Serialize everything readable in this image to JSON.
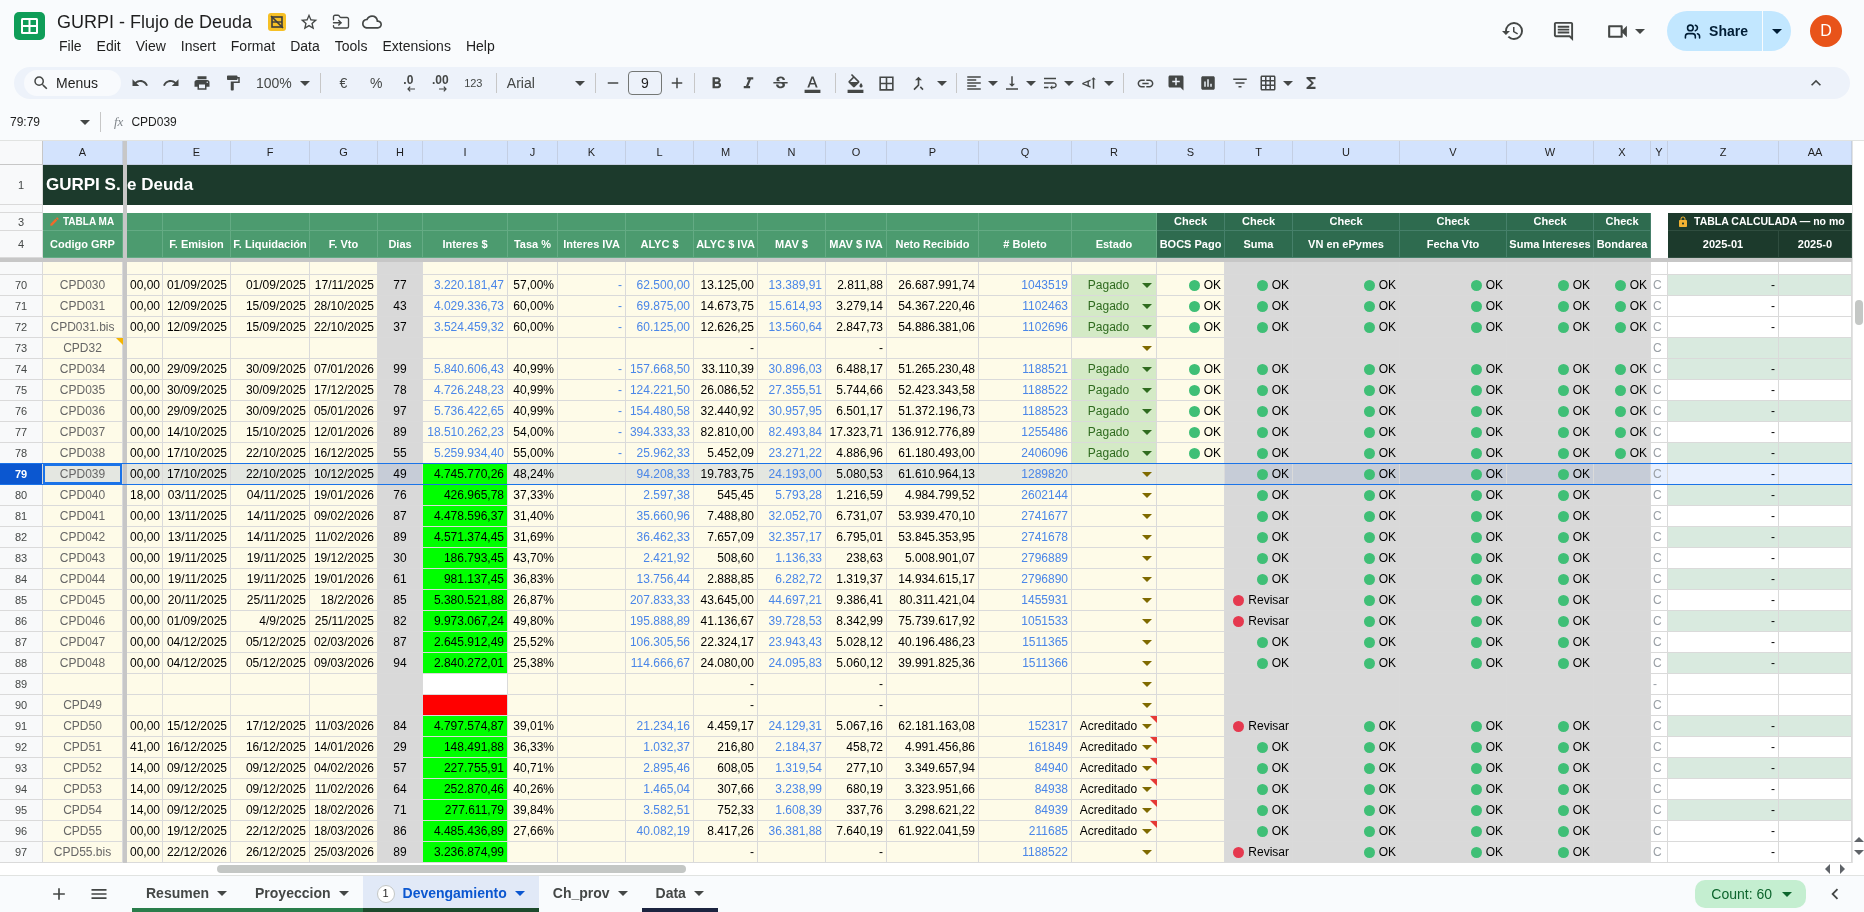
{
  "document": {
    "title": "GURPI - Flujo de Deuda",
    "starred": false
  },
  "menus": [
    "File",
    "Edit",
    "View",
    "Insert",
    "Format",
    "Data",
    "Tools",
    "Extensions",
    "Help"
  ],
  "account": {
    "share": "Share",
    "avatar": "D"
  },
  "toolbar": {
    "menu_search": "Menus",
    "zoom": "100%",
    "currency": "€",
    "percent": "%",
    "decrease_decimals": ".0",
    "increase_decimals": ".00",
    "number_format": "123",
    "font": "Arial",
    "font_size": "9"
  },
  "formula_bar": {
    "name_box": "79:79",
    "function_label": "fx",
    "formula": "CPD039"
  },
  "table": {
    "column_headers": [
      "A",
      "E",
      "F",
      "G",
      "H",
      "I",
      "J",
      "K",
      "L",
      "M",
      "N",
      "O",
      "P",
      "Q",
      "R",
      "S",
      "T",
      "U",
      "V",
      "W",
      "X",
      "Y",
      "Z",
      "AA"
    ],
    "title_row": {
      "row": "1",
      "left": "GURPI S.",
      "right": "e Deuda"
    },
    "group_row": {
      "row": "3",
      "A": "TABLA MA",
      "S": "Check",
      "T": "Check",
      "U": "Check",
      "V": "Check",
      "W": "Check",
      "X": "Check",
      "Z": "TABLA CALCULADA — no mo"
    },
    "label_row": {
      "row": "4",
      "A": "Codigo GRP",
      "E": "F. Emision",
      "F": "F. Liquidación",
      "G": "F. Vto",
      "H": "Dias",
      "I": "Interes $",
      "J": "Tasa %",
      "K": "Interes IVA",
      "L": "ALYC $",
      "M": "ALYC $ IVA",
      "N": "MAV $",
      "O": "MAV $ IVA",
      "P": "Neto Recibido",
      "Q": "# Boleto",
      "R": "Estado",
      "S": "BOCS Pago",
      "T": "Suma",
      "U": "VN en ePymes",
      "V": "Fecha Vto",
      "W": "Suma Intereses",
      "X": "Bondarea",
      "Z": "2025-01",
      "AA": "2025-0"
    },
    "rows": [
      {
        "row": "70",
        "selected": false,
        "band": true,
        "A": {
          "text": "CPD030",
          "note": false
        },
        "D": "00,00",
        "E": "01/09/2025",
        "F": "01/09/2025",
        "G": "17/11/2025",
        "H": "77",
        "I": {
          "text": "3.220.181,47"
        },
        "J": "57,00%",
        "K": "-",
        "L": "62.500,00",
        "M": "13.125,00",
        "N": "13.389,91",
        "O": "2.811,88",
        "P": "26.687.991,74",
        "Q": "1043519",
        "R": {
          "text": "Pagado",
          "color": "#d4eac6",
          "note": false
        },
        "S": {
          "text": "OK",
          "color": "#3fbf76"
        },
        "T": {
          "text": "OK",
          "color": "#3fbf76"
        },
        "U": {
          "text": "OK",
          "color": "#3fbf76"
        },
        "V": {
          "text": "OK",
          "color": "#3fbf76"
        },
        "W": {
          "text": "OK",
          "color": "#3fbf76"
        },
        "X": {
          "text": "OK",
          "color": "#3fbf76"
        },
        "Y": "C",
        "Z": "-"
      },
      {
        "row": "71",
        "selected": false,
        "band": false,
        "A": {
          "text": "CPD031",
          "note": false
        },
        "D": "00,00",
        "E": "12/09/2025",
        "F": "15/09/2025",
        "G": "28/10/2025",
        "H": "43",
        "I": {
          "text": "4.029.336,73"
        },
        "J": "60,00%",
        "K": "-",
        "L": "69.875,00",
        "M": "14.673,75",
        "N": "15.614,93",
        "O": "3.279,14",
        "P": "54.367.220,46",
        "Q": "1102463",
        "R": {
          "text": "Pagado",
          "color": "#d4eac6",
          "note": false
        },
        "S": {
          "text": "OK",
          "color": "#3fbf76"
        },
        "T": {
          "text": "OK",
          "color": "#3fbf76"
        },
        "U": {
          "text": "OK",
          "color": "#3fbf76"
        },
        "V": {
          "text": "OK",
          "color": "#3fbf76"
        },
        "W": {
          "text": "OK",
          "color": "#3fbf76"
        },
        "X": {
          "text": "OK",
          "color": "#3fbf76"
        },
        "Y": "C",
        "Z": "-"
      },
      {
        "row": "72",
        "selected": false,
        "band": false,
        "A": {
          "text": "CPD031.bis",
          "note": false
        },
        "D": "00,00",
        "E": "12/09/2025",
        "F": "15/09/2025",
        "G": "22/10/2025",
        "H": "37",
        "I": {
          "text": "3.524.459,32"
        },
        "J": "60,00%",
        "K": "-",
        "L": "60.125,00",
        "M": "12.626,25",
        "N": "13.560,64",
        "O": "2.847,73",
        "P": "54.886.381,06",
        "Q": "1102696",
        "R": {
          "text": "Pagado",
          "color": "#d4eac6",
          "note": false
        },
        "S": {
          "text": "OK",
          "color": "#3fbf76"
        },
        "T": {
          "text": "OK",
          "color": "#3fbf76"
        },
        "U": {
          "text": "OK",
          "color": "#3fbf76"
        },
        "V": {
          "text": "OK",
          "color": "#3fbf76"
        },
        "W": {
          "text": "OK",
          "color": "#3fbf76"
        },
        "X": {
          "text": "OK",
          "color": "#3fbf76"
        },
        "Y": "C",
        "Z": "-"
      },
      {
        "row": "73",
        "selected": false,
        "band": true,
        "A": {
          "text": "CPD32",
          "note": true
        },
        "M": "-",
        "O": "-",
        "R": {
          "note": false
        },
        "Y": "C"
      },
      {
        "row": "74",
        "selected": false,
        "band": true,
        "A": {
          "text": "CPD034",
          "note": false
        },
        "D": "00,00",
        "E": "29/09/2025",
        "F": "30/09/2025",
        "G": "07/01/2026",
        "H": "99",
        "I": {
          "text": "5.840.606,43"
        },
        "J": "40,99%",
        "K": "-",
        "L": "157.668,50",
        "M": "33.110,39",
        "N": "30.896,03",
        "O": "6.488,17",
        "P": "51.265.230,48",
        "Q": "1188521",
        "R": {
          "text": "Pagado",
          "color": "#d4eac6",
          "note": false
        },
        "S": {
          "text": "OK",
          "color": "#3fbf76"
        },
        "T": {
          "text": "OK",
          "color": "#3fbf76"
        },
        "U": {
          "text": "OK",
          "color": "#3fbf76"
        },
        "V": {
          "text": "OK",
          "color": "#3fbf76"
        },
        "W": {
          "text": "OK",
          "color": "#3fbf76"
        },
        "X": {
          "text": "OK",
          "color": "#3fbf76"
        },
        "Y": "C",
        "Z": "-"
      },
      {
        "row": "75",
        "selected": false,
        "band": false,
        "A": {
          "text": "CPD035",
          "note": false
        },
        "D": "00,00",
        "E": "30/09/2025",
        "F": "30/09/2025",
        "G": "17/12/2025",
        "H": "78",
        "I": {
          "text": "4.726.248,23"
        },
        "J": "40,99%",
        "K": "-",
        "L": "124.221,50",
        "M": "26.086,52",
        "N": "27.355,51",
        "O": "5.744,66",
        "P": "52.423.343,58",
        "Q": "1188522",
        "R": {
          "text": "Pagado",
          "color": "#d4eac6",
          "note": false
        },
        "S": {
          "text": "OK",
          "color": "#3fbf76"
        },
        "T": {
          "text": "OK",
          "color": "#3fbf76"
        },
        "U": {
          "text": "OK",
          "color": "#3fbf76"
        },
        "V": {
          "text": "OK",
          "color": "#3fbf76"
        },
        "W": {
          "text": "OK",
          "color": "#3fbf76"
        },
        "X": {
          "text": "OK",
          "color": "#3fbf76"
        },
        "Y": "C",
        "Z": "-"
      },
      {
        "row": "76",
        "selected": false,
        "band": true,
        "A": {
          "text": "CPD036",
          "note": false
        },
        "D": "00,00",
        "E": "29/09/2025",
        "F": "30/09/2025",
        "G": "05/01/2026",
        "H": "97",
        "I": {
          "text": "5.736.422,65"
        },
        "J": "40,99%",
        "K": "-",
        "L": "154.480,58",
        "M": "32.440,92",
        "N": "30.957,95",
        "O": "6.501,17",
        "P": "51.372.196,73",
        "Q": "1188523",
        "R": {
          "text": "Pagado",
          "color": "#d4eac6",
          "note": false
        },
        "S": {
          "text": "OK",
          "color": "#3fbf76"
        },
        "T": {
          "text": "OK",
          "color": "#3fbf76"
        },
        "U": {
          "text": "OK",
          "color": "#3fbf76"
        },
        "V": {
          "text": "OK",
          "color": "#3fbf76"
        },
        "W": {
          "text": "OK",
          "color": "#3fbf76"
        },
        "X": {
          "text": "OK",
          "color": "#3fbf76"
        },
        "Y": "C",
        "Z": "-"
      },
      {
        "row": "77",
        "selected": false,
        "band": false,
        "A": {
          "text": "CPD037",
          "note": false
        },
        "D": "00,00",
        "E": "14/10/2025",
        "F": "15/10/2025",
        "G": "12/01/2026",
        "H": "89",
        "I": {
          "text": "18.510.262,23"
        },
        "J": "54,00%",
        "K": "-",
        "L": "394.333,33",
        "M": "82.810,00",
        "N": "82.493,84",
        "O": "17.323,71",
        "P": "136.912.776,89",
        "Q": "1255486",
        "R": {
          "text": "Pagado",
          "color": "#d4eac6",
          "note": false
        },
        "S": {
          "text": "OK",
          "color": "#3fbf76"
        },
        "T": {
          "text": "OK",
          "color": "#3fbf76"
        },
        "U": {
          "text": "OK",
          "color": "#3fbf76"
        },
        "V": {
          "text": "OK",
          "color": "#3fbf76"
        },
        "W": {
          "text": "OK",
          "color": "#3fbf76"
        },
        "X": {
          "text": "OK",
          "color": "#3fbf76"
        },
        "Y": "C",
        "Z": "-"
      },
      {
        "row": "78",
        "selected": false,
        "band": true,
        "A": {
          "text": "CPD038",
          "note": false
        },
        "D": "00,00",
        "E": "17/10/2025",
        "F": "22/10/2025",
        "G": "16/12/2025",
        "H": "55",
        "I": {
          "text": "5.259.934,40"
        },
        "J": "55,00%",
        "K": "-",
        "L": "25.962,33",
        "M": "5.452,09",
        "N": "23.271,22",
        "O": "4.886,96",
        "P": "61.180.493,00",
        "Q": "2406096",
        "R": {
          "text": "Pagado",
          "color": "#d4eac6",
          "note": false
        },
        "S": {
          "text": "OK",
          "color": "#3fbf76"
        },
        "T": {
          "text": "OK",
          "color": "#3fbf76"
        },
        "U": {
          "text": "OK",
          "color": "#3fbf76"
        },
        "V": {
          "text": "OK",
          "color": "#3fbf76"
        },
        "W": {
          "text": "OK",
          "color": "#3fbf76"
        },
        "X": {
          "text": "OK",
          "color": "#3fbf76"
        },
        "Y": "C",
        "Z": "-"
      },
      {
        "row": "79",
        "selected": true,
        "band": false,
        "A": {
          "text": "CPD039",
          "note": false
        },
        "D": "00,00",
        "E": "17/10/2025",
        "F": "22/10/2025",
        "G": "10/12/2025",
        "H": "49",
        "I": {
          "text": "4.745.770,26",
          "color": "#00ff00"
        },
        "J": "48,24%",
        "L": "94.208,33",
        "M": "19.783,75",
        "N": "24.193,00",
        "O": "5.080,53",
        "P": "61.610.964,13",
        "Q": "1289820",
        "R": {
          "note": false
        },
        "T": {
          "text": "OK",
          "color": "#3fbf76"
        },
        "U": {
          "text": "OK",
          "color": "#3fbf76"
        },
        "V": {
          "text": "OK",
          "color": "#3fbf76"
        },
        "W": {
          "text": "OK",
          "color": "#3fbf76"
        },
        "Y": "C",
        "Z": "-"
      },
      {
        "row": "80",
        "selected": false,
        "band": true,
        "A": {
          "text": "CPD040",
          "note": false
        },
        "D": "18,00",
        "E": "03/11/2025",
        "F": "04/11/2025",
        "G": "19/01/2026",
        "H": "76",
        "I": {
          "text": "426.965,78",
          "color": "#00ff00"
        },
        "J": "37,33%",
        "L": "2.597,38",
        "M": "545,45",
        "N": "5.793,28",
        "O": "1.216,59",
        "P": "4.984.799,52",
        "Q": "2602144",
        "R": {
          "note": false
        },
        "T": {
          "text": "OK",
          "color": "#3fbf76"
        },
        "U": {
          "text": "OK",
          "color": "#3fbf76"
        },
        "V": {
          "text": "OK",
          "color": "#3fbf76"
        },
        "W": {
          "text": "OK",
          "color": "#3fbf76"
        },
        "Y": "C",
        "Z": "-"
      },
      {
        "row": "81",
        "selected": false,
        "band": false,
        "A": {
          "text": "CPD041",
          "note": false
        },
        "D": "00,00",
        "E": "13/11/2025",
        "F": "14/11/2025",
        "G": "09/02/2026",
        "H": "87",
        "I": {
          "text": "4.478.596,37",
          "color": "#00ff00"
        },
        "J": "31,40%",
        "L": "35.660,96",
        "M": "7.488,80",
        "N": "32.052,70",
        "O": "6.731,07",
        "P": "53.939.470,10",
        "Q": "2741677",
        "R": {
          "note": false
        },
        "T": {
          "text": "OK",
          "color": "#3fbf76"
        },
        "U": {
          "text": "OK",
          "color": "#3fbf76"
        },
        "V": {
          "text": "OK",
          "color": "#3fbf76"
        },
        "W": {
          "text": "OK",
          "color": "#3fbf76"
        },
        "Y": "C",
        "Z": "-"
      },
      {
        "row": "82",
        "selected": false,
        "band": true,
        "A": {
          "text": "CPD042",
          "note": false
        },
        "D": "00,00",
        "E": "13/11/2025",
        "F": "14/11/2025",
        "G": "11/02/2026",
        "H": "89",
        "I": {
          "text": "4.571.374,45",
          "color": "#00ff00"
        },
        "J": "31,69%",
        "L": "36.462,33",
        "M": "7.657,09",
        "N": "32.357,17",
        "O": "6.795,01",
        "P": "53.845.353,95",
        "Q": "2741678",
        "R": {
          "note": false
        },
        "T": {
          "text": "OK",
          "color": "#3fbf76"
        },
        "U": {
          "text": "OK",
          "color": "#3fbf76"
        },
        "V": {
          "text": "OK",
          "color": "#3fbf76"
        },
        "W": {
          "text": "OK",
          "color": "#3fbf76"
        },
        "Y": "C",
        "Z": "-"
      },
      {
        "row": "83",
        "selected": false,
        "band": false,
        "A": {
          "text": "CPD043",
          "note": false
        },
        "D": "00,00",
        "E": "19/11/2025",
        "F": "19/11/2025",
        "G": "19/12/2025",
        "H": "30",
        "I": {
          "text": "186.793,45",
          "color": "#00ff00"
        },
        "J": "43,70%",
        "L": "2.421,92",
        "M": "508,60",
        "N": "1.136,33",
        "O": "238,63",
        "P": "5.008.901,07",
        "Q": "2796889",
        "R": {
          "note": false
        },
        "T": {
          "text": "OK",
          "color": "#3fbf76"
        },
        "U": {
          "text": "OK",
          "color": "#3fbf76"
        },
        "V": {
          "text": "OK",
          "color": "#3fbf76"
        },
        "W": {
          "text": "OK",
          "color": "#3fbf76"
        },
        "Y": "C",
        "Z": "-"
      },
      {
        "row": "84",
        "selected": false,
        "band": true,
        "A": {
          "text": "CPD044",
          "note": false
        },
        "D": "00,00",
        "E": "19/11/2025",
        "F": "19/11/2025",
        "G": "19/01/2026",
        "H": "61",
        "I": {
          "text": "981.137,45",
          "color": "#00ff00"
        },
        "J": "36,83%",
        "L": "13.756,44",
        "M": "2.888,85",
        "N": "6.282,72",
        "O": "1.319,37",
        "P": "14.934.615,17",
        "Q": "2796890",
        "R": {
          "note": false
        },
        "T": {
          "text": "OK",
          "color": "#3fbf76"
        },
        "U": {
          "text": "OK",
          "color": "#3fbf76"
        },
        "V": {
          "text": "OK",
          "color": "#3fbf76"
        },
        "W": {
          "text": "OK",
          "color": "#3fbf76"
        },
        "Y": "C",
        "Z": "-"
      },
      {
        "row": "85",
        "selected": false,
        "band": false,
        "A": {
          "text": "CPD045",
          "note": false
        },
        "D": "00,00",
        "E": "20/11/2025",
        "F": "25/11/2025",
        "G": "18/2/2026",
        "H": "85",
        "I": {
          "text": "5.380.521,88",
          "color": "#00ff00"
        },
        "J": "26,87%",
        "L": "207.833,33",
        "M": "43.645,00",
        "N": "44.697,21",
        "O": "9.386,41",
        "P": "80.311.421,04",
        "Q": "1455931",
        "R": {
          "note": false
        },
        "T": {
          "text": "Revisar",
          "color": "#e5394f"
        },
        "U": {
          "text": "OK",
          "color": "#3fbf76"
        },
        "V": {
          "text": "OK",
          "color": "#3fbf76"
        },
        "W": {
          "text": "OK",
          "color": "#3fbf76"
        },
        "Y": "C",
        "Z": "-"
      },
      {
        "row": "86",
        "selected": false,
        "band": true,
        "A": {
          "text": "CPD046",
          "note": false
        },
        "D": "00,00",
        "E": "01/09/2025",
        "F": "4/9/2025",
        "G": "25/11/2025",
        "H": "82",
        "I": {
          "text": "9.973.067,24",
          "color": "#00ff00"
        },
        "J": "49,80%",
        "L": "195.888,89",
        "M": "41.136,67",
        "N": "39.728,53",
        "O": "8.342,99",
        "P": "75.739.617,92",
        "Q": "1051533",
        "R": {
          "note": false
        },
        "T": {
          "text": "Revisar",
          "color": "#e5394f"
        },
        "U": {
          "text": "OK",
          "color": "#3fbf76"
        },
        "V": {
          "text": "OK",
          "color": "#3fbf76"
        },
        "W": {
          "text": "OK",
          "color": "#3fbf76"
        },
        "Y": "C",
        "Z": "-"
      },
      {
        "row": "87",
        "selected": false,
        "band": false,
        "A": {
          "text": "CPD047",
          "note": false
        },
        "D": "00,00",
        "E": "04/12/2025",
        "F": "05/12/2025",
        "G": "02/03/2026",
        "H": "87",
        "I": {
          "text": "2.645.912,49",
          "color": "#00ff00"
        },
        "J": "25,52%",
        "L": "106.305,56",
        "M": "22.324,17",
        "N": "23.943,43",
        "O": "5.028,12",
        "P": "40.196.486,23",
        "Q": "1511365",
        "R": {
          "note": false
        },
        "T": {
          "text": "OK",
          "color": "#3fbf76"
        },
        "U": {
          "text": "OK",
          "color": "#3fbf76"
        },
        "V": {
          "text": "OK",
          "color": "#3fbf76"
        },
        "W": {
          "text": "OK",
          "color": "#3fbf76"
        },
        "Y": "C",
        "Z": "-"
      },
      {
        "row": "88",
        "selected": false,
        "band": true,
        "A": {
          "text": "CPD048",
          "note": false
        },
        "D": "00,00",
        "E": "04/12/2025",
        "F": "05/12/2025",
        "G": "09/03/2026",
        "H": "94",
        "I": {
          "text": "2.840.272,01",
          "color": "#00ff00"
        },
        "J": "25,38%",
        "L": "114.666,67",
        "M": "24.080,00",
        "N": "24.095,83",
        "O": "5.060,12",
        "P": "39.991.825,36",
        "Q": "1511366",
        "R": {
          "note": false
        },
        "T": {
          "text": "OK",
          "color": "#3fbf76"
        },
        "U": {
          "text": "OK",
          "color": "#3fbf76"
        },
        "V": {
          "text": "OK",
          "color": "#3fbf76"
        },
        "W": {
          "text": "OK",
          "color": "#3fbf76"
        },
        "Y": "C",
        "Z": "-"
      },
      {
        "row": "89",
        "selected": false,
        "band": false,
        "A": {
          "note": false
        },
        "I": {
          "color": "#ffffff"
        },
        "M": "-",
        "O": "-",
        "R": {
          "note": false
        },
        "Y": "-"
      },
      {
        "row": "90",
        "selected": false,
        "band": false,
        "A": {
          "text": "CPD49",
          "note": false
        },
        "I": {
          "color": "#ff0000"
        },
        "M": "-",
        "O": "-",
        "R": {
          "note": false
        },
        "Y": "C"
      },
      {
        "row": "91",
        "selected": false,
        "band": true,
        "A": {
          "text": "CPD50",
          "note": false
        },
        "D": "00,00",
        "E": "15/12/2025",
        "F": "17/12/2025",
        "G": "11/03/2026",
        "H": "84",
        "I": {
          "text": "4.797.574,87",
          "color": "#00ff00"
        },
        "J": "39,01%",
        "L": "21.234,16",
        "M": "4.459,17",
        "N": "24.129,31",
        "O": "5.067,16",
        "P": "62.181.163,08",
        "Q": "152317",
        "R": {
          "text": "Acreditado",
          "note": true
        },
        "T": {
          "text": "Revisar",
          "color": "#e5394f"
        },
        "U": {
          "text": "OK",
          "color": "#3fbf76"
        },
        "V": {
          "text": "OK",
          "color": "#3fbf76"
        },
        "W": {
          "text": "OK",
          "color": "#3fbf76"
        },
        "Y": "C",
        "Z": "-"
      },
      {
        "row": "92",
        "selected": false,
        "band": false,
        "A": {
          "text": "CPD51",
          "note": false
        },
        "D": "41,00",
        "E": "16/12/2025",
        "F": "16/12/2025",
        "G": "14/01/2026",
        "H": "29",
        "I": {
          "text": "148.491,88",
          "color": "#00ff00"
        },
        "J": "36,33%",
        "L": "1.032,37",
        "M": "216,80",
        "N": "2.184,37",
        "O": "458,72",
        "P": "4.991.456,86",
        "Q": "161849",
        "R": {
          "text": "Acreditado",
          "note": true
        },
        "T": {
          "text": "OK",
          "color": "#3fbf76"
        },
        "U": {
          "text": "OK",
          "color": "#3fbf76"
        },
        "V": {
          "text": "OK",
          "color": "#3fbf76"
        },
        "W": {
          "text": "OK",
          "color": "#3fbf76"
        },
        "Y": "C",
        "Z": "-"
      },
      {
        "row": "93",
        "selected": false,
        "band": true,
        "A": {
          "text": "CPD52",
          "note": false
        },
        "D": "14,00",
        "E": "09/12/2025",
        "F": "09/12/2025",
        "G": "04/02/2026",
        "H": "57",
        "I": {
          "text": "227.755,91",
          "color": "#00ff00"
        },
        "J": "40,71%",
        "L": "2.895,46",
        "M": "608,05",
        "N": "1.319,54",
        "O": "277,10",
        "P": "3.349.657,94",
        "Q": "84940",
        "R": {
          "text": "Acreditado",
          "note": true
        },
        "T": {
          "text": "OK",
          "color": "#3fbf76"
        },
        "U": {
          "text": "OK",
          "color": "#3fbf76"
        },
        "V": {
          "text": "OK",
          "color": "#3fbf76"
        },
        "W": {
          "text": "OK",
          "color": "#3fbf76"
        },
        "Y": "C",
        "Z": "-"
      },
      {
        "row": "94",
        "selected": false,
        "band": false,
        "A": {
          "text": "CPD53",
          "note": false
        },
        "D": "14,00",
        "E": "09/12/2025",
        "F": "09/12/2025",
        "G": "11/02/2026",
        "H": "64",
        "I": {
          "text": "252.870,46",
          "color": "#00ff00"
        },
        "J": "40,26%",
        "L": "1.465,04",
        "M": "307,66",
        "N": "3.238,99",
        "O": "680,19",
        "P": "3.323.951,66",
        "Q": "84938",
        "R": {
          "text": "Acreditado",
          "note": true
        },
        "T": {
          "text": "OK",
          "color": "#3fbf76"
        },
        "U": {
          "text": "OK",
          "color": "#3fbf76"
        },
        "V": {
          "text": "OK",
          "color": "#3fbf76"
        },
        "W": {
          "text": "OK",
          "color": "#3fbf76"
        },
        "Y": "C",
        "Z": "-"
      },
      {
        "row": "95",
        "selected": false,
        "band": true,
        "A": {
          "text": "CPD54",
          "note": false
        },
        "D": "14,00",
        "E": "09/12/2025",
        "F": "09/12/2025",
        "G": "18/02/2026",
        "H": "71",
        "I": {
          "text": "277.611,79",
          "color": "#00ff00"
        },
        "J": "39,84%",
        "L": "3.582,51",
        "M": "752,33",
        "N": "1.608,39",
        "O": "337,76",
        "P": "3.298.621,22",
        "Q": "84939",
        "R": {
          "text": "Acreditado",
          "note": true
        },
        "T": {
          "text": "OK",
          "color": "#3fbf76"
        },
        "U": {
          "text": "OK",
          "color": "#3fbf76"
        },
        "V": {
          "text": "OK",
          "color": "#3fbf76"
        },
        "W": {
          "text": "OK",
          "color": "#3fbf76"
        },
        "Y": "C",
        "Z": "-"
      },
      {
        "row": "96",
        "selected": false,
        "band": false,
        "A": {
          "text": "CPD55",
          "note": false
        },
        "D": "00,00",
        "E": "19/12/2025",
        "F": "22/12/2025",
        "G": "18/03/2026",
        "H": "86",
        "I": {
          "text": "4.485.436,89",
          "color": "#00ff00"
        },
        "J": "27,66%",
        "L": "40.082,19",
        "M": "8.417,26",
        "N": "36.381,88",
        "O": "7.640,19",
        "P": "61.922.041,59",
        "Q": "211685",
        "R": {
          "text": "Acreditado",
          "note": true
        },
        "T": {
          "text": "OK",
          "color": "#3fbf76"
        },
        "U": {
          "text": "OK",
          "color": "#3fbf76"
        },
        "V": {
          "text": "OK",
          "color": "#3fbf76"
        },
        "W": {
          "text": "OK",
          "color": "#3fbf76"
        },
        "Y": "C",
        "Z": "-"
      },
      {
        "row": "97",
        "selected": false,
        "band": false,
        "A": {
          "text": "CPD55.bis",
          "note": false
        },
        "D": "00,00",
        "E": "22/12/2026",
        "F": "26/12/2025",
        "G": "25/03/2026",
        "H": "89",
        "I": {
          "text": "3.236.874,99",
          "color": "#00ff00"
        },
        "M": "-",
        "O": "-",
        "Q": "1188522",
        "R": {
          "note": false
        },
        "T": {
          "text": "Revisar",
          "color": "#e5394f"
        },
        "U": {
          "text": "OK",
          "color": "#3fbf76"
        },
        "V": {
          "text": "OK",
          "color": "#3fbf76"
        },
        "W": {
          "text": "OK",
          "color": "#3fbf76"
        },
        "Y": "C",
        "Z": "-"
      }
    ]
  },
  "sheet_tabs": [
    {
      "label": "Resumen",
      "selected": false,
      "color": "#2a7d4b"
    },
    {
      "label": "Proyeccion",
      "selected": false,
      "color": "#2a7d4b"
    },
    {
      "label": "Devengamiento",
      "selected": true,
      "color": "#1d4a2c",
      "badge": "1"
    },
    {
      "label": "Ch_prov",
      "selected": false
    },
    {
      "label": "Data",
      "selected": false,
      "color": "#1c2440"
    }
  ],
  "status": {
    "summary": "Count: 60"
  }
}
